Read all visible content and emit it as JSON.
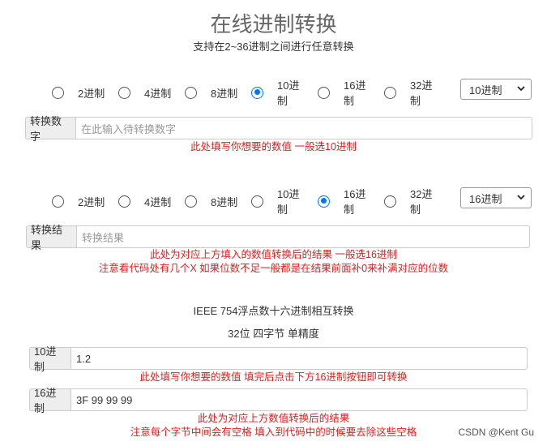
{
  "page": {
    "title": "在线进制转换",
    "subtitle": "支持在2~36进制之间进行任意转换"
  },
  "input_section": {
    "radios": [
      "2进制",
      "4进制",
      "8进制",
      "10进制",
      "16进制",
      "32进制"
    ],
    "selected": "10进制",
    "select_value": "10进制",
    "addon_label": "转换数字",
    "field_placeholder": "在此输入待转换数字",
    "note": "此处填写你想要的数值 一般选10进制"
  },
  "output_section": {
    "radios": [
      "2进制",
      "4进制",
      "8进制",
      "10进制",
      "16进制",
      "32进制"
    ],
    "selected": "16进制",
    "select_value": "16进制",
    "addon_label": "转换结果",
    "field_placeholder": "转换结果",
    "note_1": "此处为对应上方填入的数值转换后的结果 一般选16进制",
    "note_2": "注意看代码处有几个X 如果位数不足一般都是在结果前面补0来补满对应的位数"
  },
  "ieee_section": {
    "heading": "IEEE 754浮点数十六进制相互转换",
    "subheading": "32位 四字节 单精度",
    "dec_button": "10进制",
    "dec_value": "1.2",
    "dec_note": "此处填写你想要的数值 填完后点击下方16进制按钮即可转换",
    "hex_button": "16进制",
    "hex_value": "3F 99 99 99",
    "hex_note_1": "此处为对应上方数值转换后的结果",
    "hex_note_2": "注意每个字节中间会有空格 填入到代码中的时候要去除这些空格"
  },
  "watermark": "CSDN @Kent Gu",
  "colors": {
    "accent": "#0075ff",
    "note": "#e02020"
  }
}
